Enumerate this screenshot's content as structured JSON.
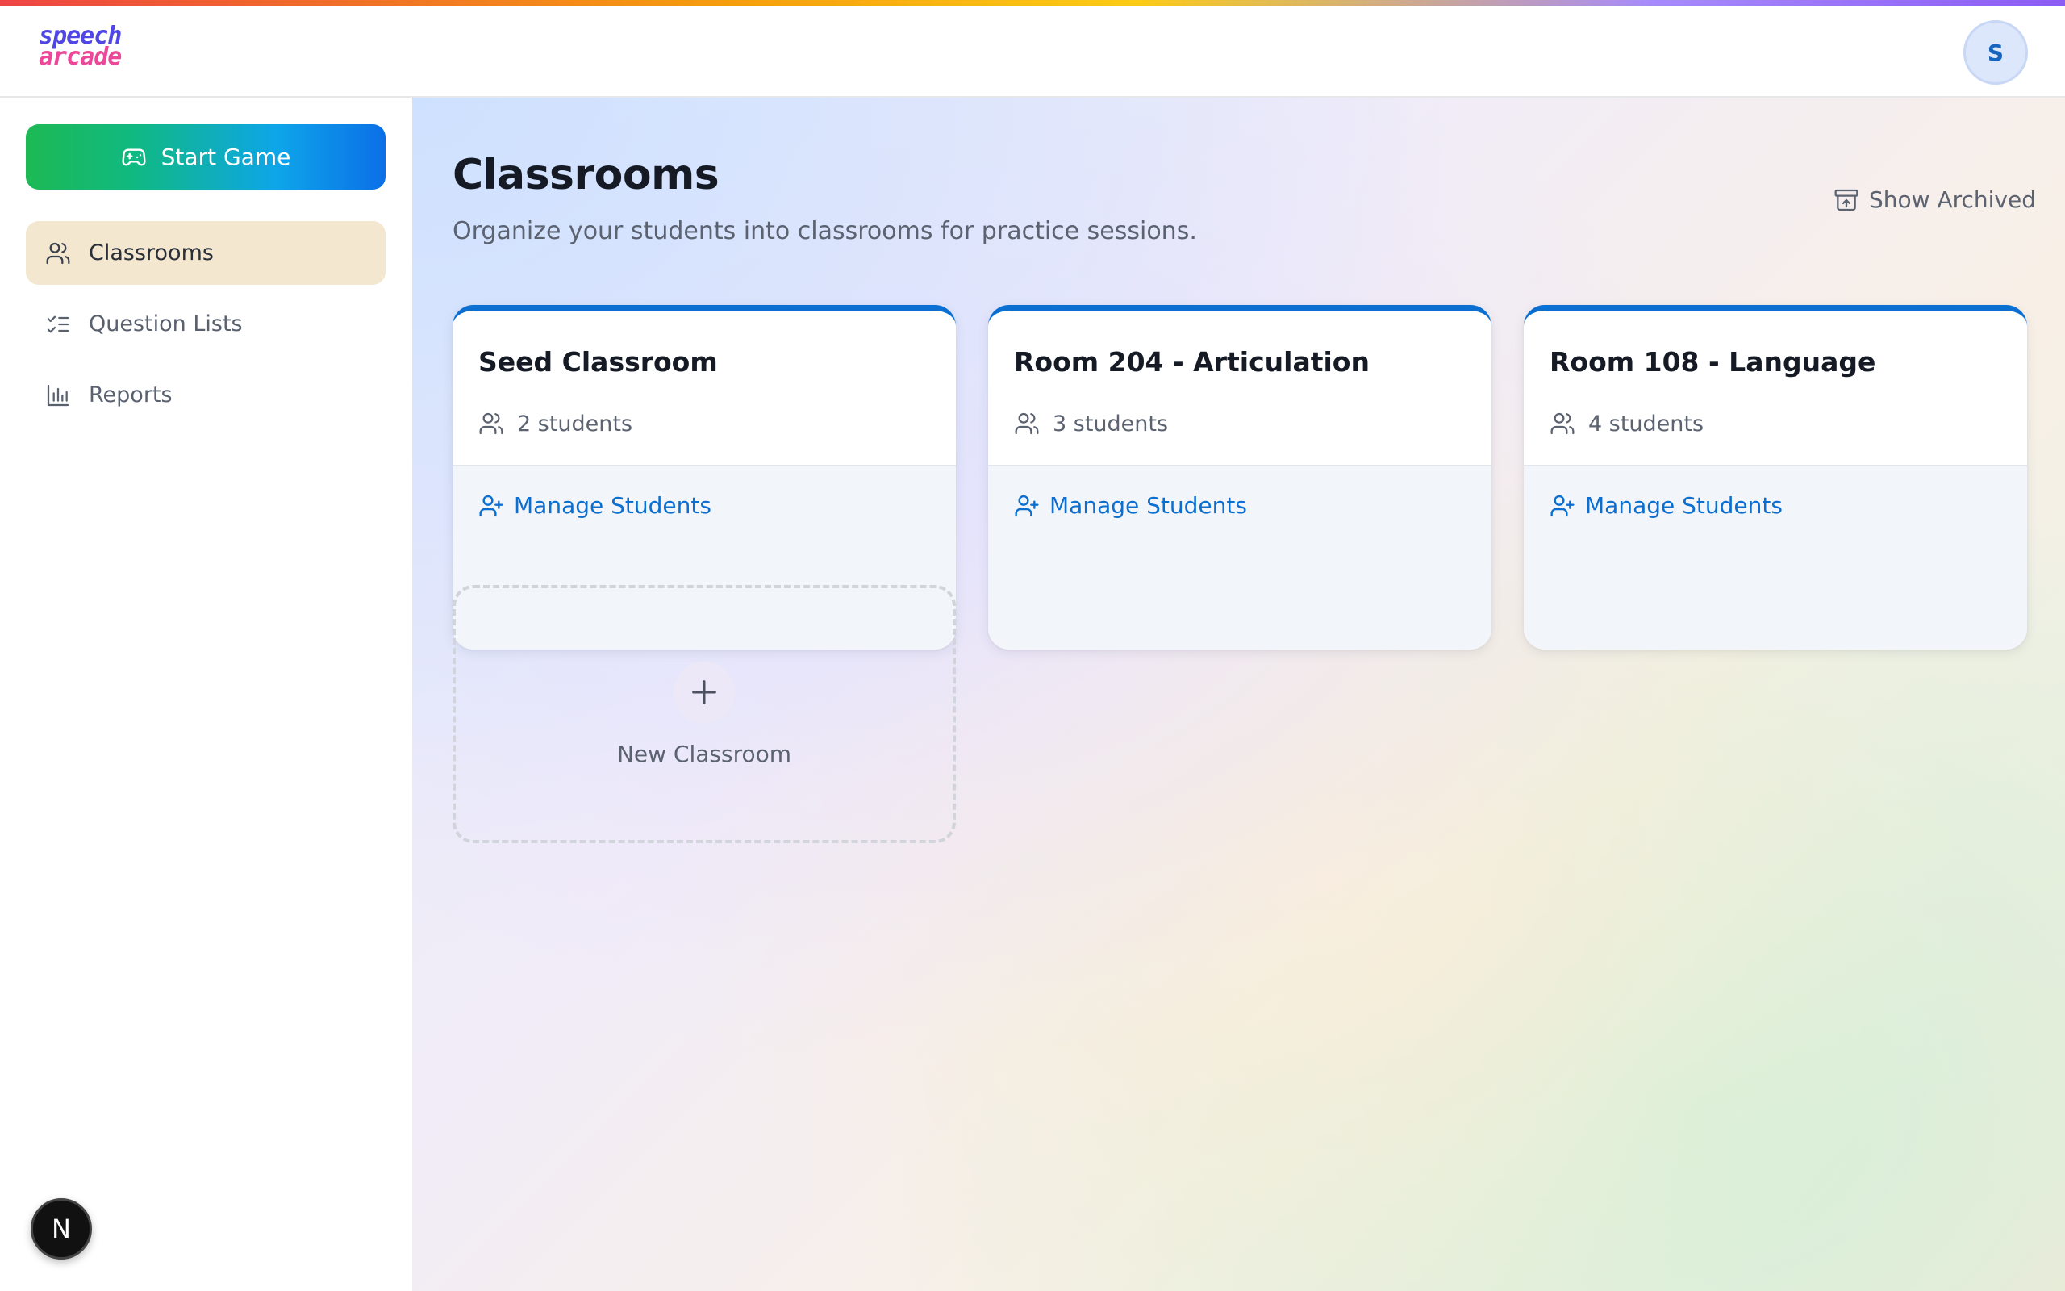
{
  "app": {
    "logo_line1": "speech",
    "logo_line2": "arcade",
    "avatar_initial": "S",
    "dev_badge": "N"
  },
  "sidebar": {
    "start_game_label": "Start Game",
    "items": [
      {
        "label": "Classrooms",
        "icon": "users-icon",
        "active": true
      },
      {
        "label": "Question Lists",
        "icon": "list-checks-icon",
        "active": false
      },
      {
        "label": "Reports",
        "icon": "bar-chart-icon",
        "active": false
      }
    ]
  },
  "main": {
    "title": "Classrooms",
    "subtitle": "Organize your students into classrooms for practice sessions.",
    "show_archived_label": "Show Archived",
    "classrooms": [
      {
        "name": "Seed Classroom",
        "count_label": "2 students",
        "action_label": "Manage Students"
      },
      {
        "name": "Room 204 - Articulation",
        "count_label": "3 students",
        "action_label": "Manage Students"
      },
      {
        "name": "Room 108 - Language",
        "count_label": "4 students",
        "action_label": "Manage Students"
      }
    ],
    "new_classroom_label": "New Classroom"
  },
  "colors": {
    "accent_blue": "#0b6fd1",
    "active_nav_bg": "#f3e7d0",
    "start_gradient_from": "#1db954",
    "start_gradient_to": "#0b6fe8"
  }
}
